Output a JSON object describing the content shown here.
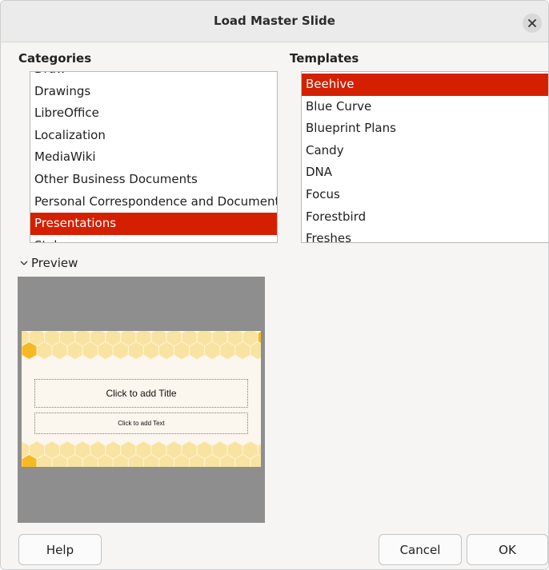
{
  "dialog": {
    "title": "Load Master Slide"
  },
  "categories": {
    "label": "Categories",
    "items": [
      "Draw",
      "Drawings",
      "LibreOffice",
      "Localization",
      "MediaWiki",
      "Other Business Documents",
      "Personal Correspondence and Documents",
      "Presentations",
      "Styles"
    ],
    "selected": "Presentations"
  },
  "templates": {
    "label": "Templates",
    "items": [
      "Beehive",
      "Blue Curve",
      "Blueprint Plans",
      "Candy",
      "DNA",
      "Focus",
      "Forestbird",
      "Freshes"
    ],
    "selected": "Beehive"
  },
  "preview": {
    "label": "Preview",
    "expanded": true,
    "slide": {
      "title_placeholder": "Click to add Title",
      "text_placeholder": "Click to add Text"
    }
  },
  "buttons": {
    "help": "Help",
    "cancel": "Cancel",
    "ok": "OK"
  },
  "colors": {
    "selection": "#d42000",
    "honeycomb_light": "#f8e3a2",
    "honeycomb_dark": "#f6b823",
    "preview_background": "#8e8e8e"
  }
}
